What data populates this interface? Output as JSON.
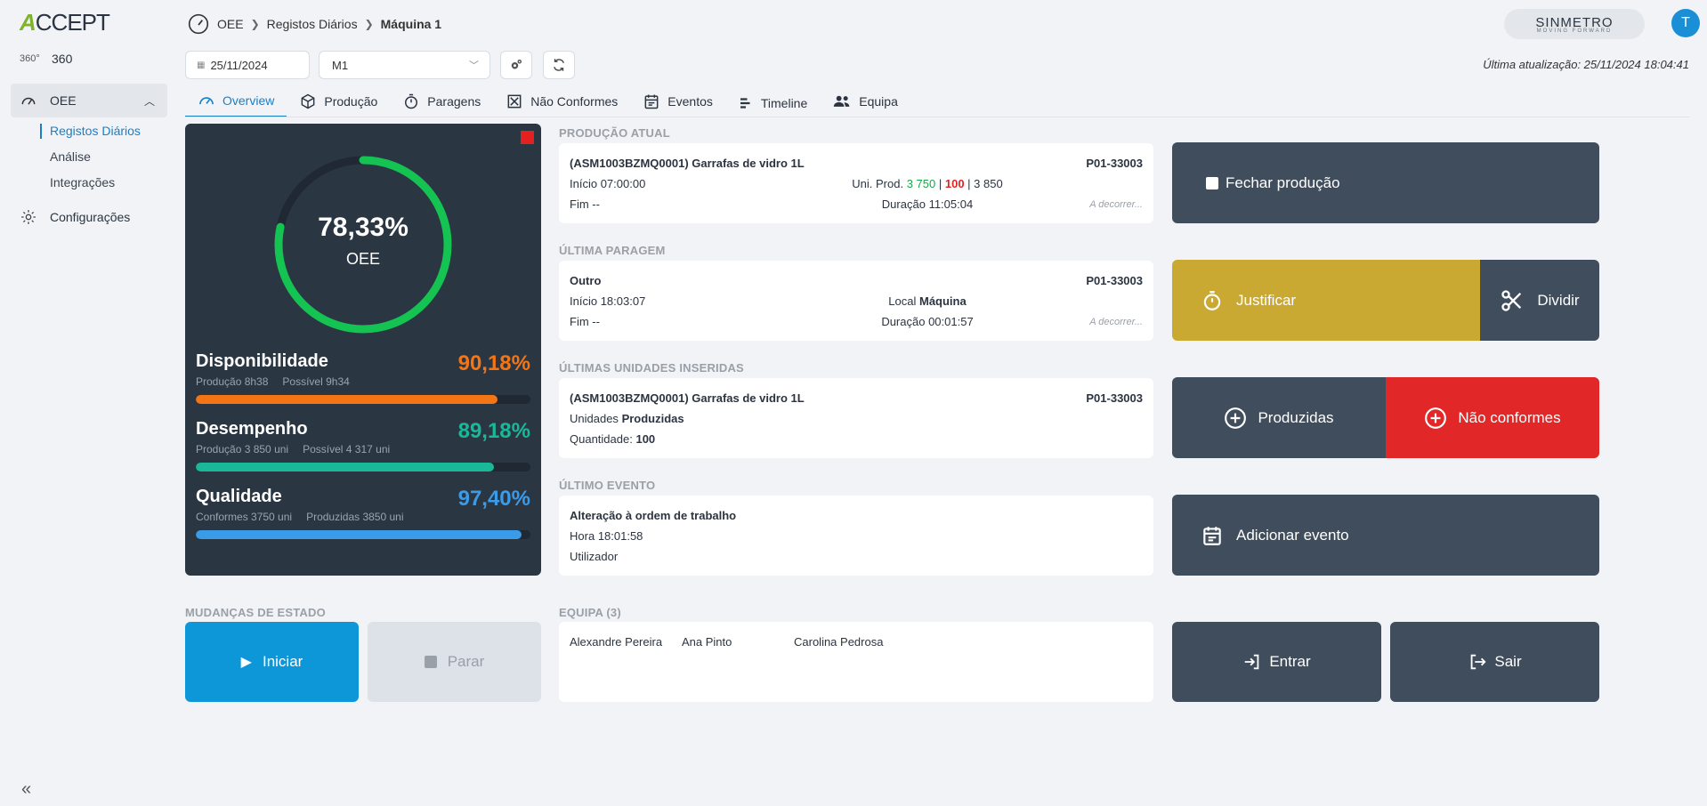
{
  "sidebar": {
    "logo": "CCEPT",
    "logo_prefix": "A",
    "item_360_icon": "360°",
    "item_360": "360",
    "oee": "OEE",
    "sub_registos": "Registos Diários",
    "sub_analise": "Análise",
    "sub_integracoes": "Integrações",
    "configuracoes": "Configurações",
    "collapse": "«"
  },
  "header": {
    "crumb_oee": "OEE",
    "crumb_registos": "Registos Diários",
    "crumb_maquina": "Máquina 1",
    "brand_name": "SINMETRO",
    "brand_tag": "MOVING FORWARD",
    "avatar": "T"
  },
  "toolbar": {
    "date": "25/11/2024",
    "machine": "M1",
    "last_update": "Última atualização: 25/11/2024 18:04:41"
  },
  "tabs": [
    {
      "label": "Overview"
    },
    {
      "label": "Produção"
    },
    {
      "label": "Paragens"
    },
    {
      "label": "Não Conformes"
    },
    {
      "label": "Eventos"
    },
    {
      "label": "Timeline"
    },
    {
      "label": "Equipa"
    }
  ],
  "oee": {
    "value": "78,33%",
    "label": "OEE",
    "fraction": 0.7833,
    "metrics": [
      {
        "name": "Disponibilidade",
        "pct": "90,18%",
        "sub1": "Produção 8h38",
        "sub2": "Possível 9h34",
        "fraction": 0.9018,
        "color": "#f47514"
      },
      {
        "name": "Desempenho",
        "pct": "89,18%",
        "sub1": "Produção 3 850 uni",
        "sub2": "Possível 4 317 uni",
        "fraction": 0.8918,
        "color": "#19b898"
      },
      {
        "name": "Qualidade",
        "pct": "97,40%",
        "sub1": "Conformes 3750 uni",
        "sub2": "Produzidas 3850 uni",
        "fraction": 0.974,
        "color": "#3a9be8"
      }
    ]
  },
  "producao_atual": {
    "title": "PRODUÇÃO ATUAL",
    "product": "(ASM1003BZMQ0001) Garrafas de vidro 1L",
    "code": "P01-33003",
    "inicio_label": "Início",
    "inicio": "07:00:00",
    "uni_label": "Uni. Prod.",
    "uni_ok": "3 750",
    "uni_nok": "100",
    "uni_total": "3 850",
    "fim_label": "Fim",
    "fim": "--",
    "duracao_label": "Duração",
    "duracao": "11:05:04",
    "status": "A decorrer..."
  },
  "ultima_paragem": {
    "title": "ÚLTIMA PARAGEM",
    "name": "Outro",
    "code": "P01-33003",
    "inicio_label": "Início",
    "inicio": "18:03:07",
    "local_label": "Local",
    "local": "Máquina",
    "fim_label": "Fim",
    "fim": "--",
    "duracao_label": "Duração",
    "duracao": "00:01:57",
    "status": "A decorrer..."
  },
  "ultimas_unidades": {
    "title": "ÚLTIMAS UNIDADES INSERIDAS",
    "product": "(ASM1003BZMQ0001) Garrafas de vidro 1L",
    "code": "P01-33003",
    "unidades_label": "Unidades",
    "unidades": "Produzidas",
    "quantidade_label": "Quantidade:",
    "quantidade": "100"
  },
  "ultimo_evento": {
    "title": "ÚLTIMO EVENTO",
    "name": "Alteração à ordem de trabalho",
    "hora_label": "Hora",
    "hora": "18:01:58",
    "utilizador_label": "Utilizador"
  },
  "mudancas": {
    "title": "MUDANÇAS DE ESTADO",
    "iniciar": "Iniciar",
    "parar": "Parar"
  },
  "equipa": {
    "title": "EQUIPA (3)",
    "members": [
      "Alexandre Pereira",
      "Ana Pinto",
      "Carolina Pedrosa"
    ]
  },
  "actions": {
    "fechar": "Fechar produção",
    "justificar": "Justificar",
    "dividir": "Dividir",
    "produzidas": "Produzidas",
    "nao_conformes": "Não conformes",
    "adicionar_evento": "Adicionar evento",
    "entrar": "Entrar",
    "sair": "Sair"
  }
}
